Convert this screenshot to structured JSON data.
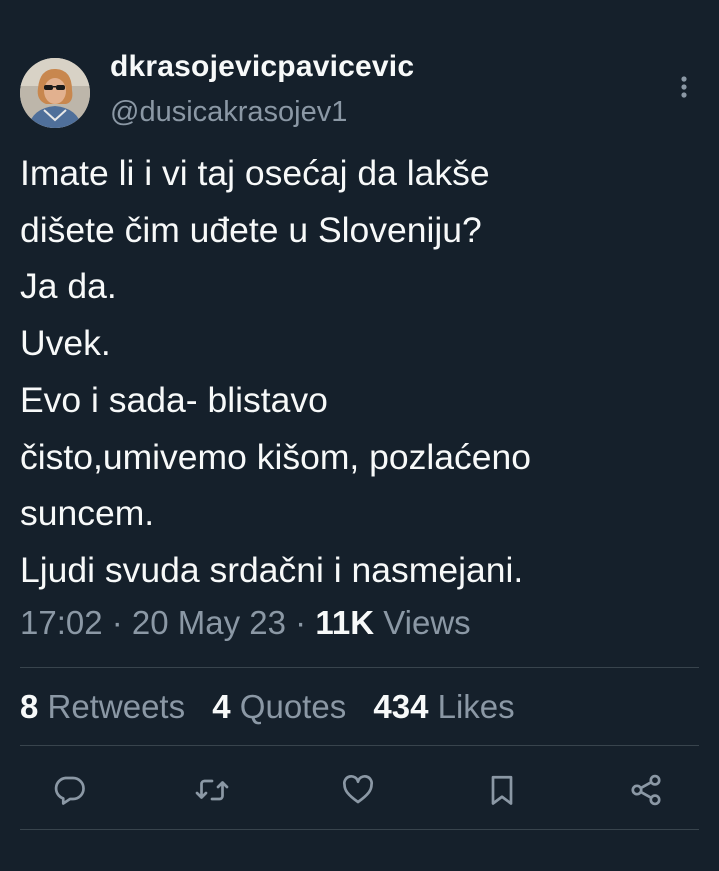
{
  "author": {
    "display_name": "dkrasojevicpavicevic",
    "handle": "@dusicakrasojev1"
  },
  "tweet": {
    "text": "Imate li i vi taj osećaj da lakše\ndišete čim uđete u Sloveniju?\nJa da.\nUvek.\nEvo i sada- blistavo\nčisto,umivemo kišom, pozlaćeno\nsuncem.\nLjudi svuda srdačni i nasmejani."
  },
  "meta": {
    "time": "17:02",
    "sep1": " · ",
    "date": "20 May 23",
    "sep2": " · ",
    "views_count": "11K",
    "views_label": " Views"
  },
  "stats": {
    "retweets_count": "8",
    "retweets_label": " Retweets",
    "quotes_count": "4",
    "quotes_label": " Quotes",
    "likes_count": "434",
    "likes_label": " Likes"
  },
  "icons": {
    "more": "more-vertical-icon",
    "reply": "reply-icon",
    "retweet": "retweet-icon",
    "like": "heart-icon",
    "bookmark": "bookmark-icon",
    "share": "share-icon"
  },
  "colors": {
    "background": "#15202b",
    "text_primary": "#f7f9f9",
    "text_secondary": "#8b98a5",
    "divider": "#38444d"
  }
}
